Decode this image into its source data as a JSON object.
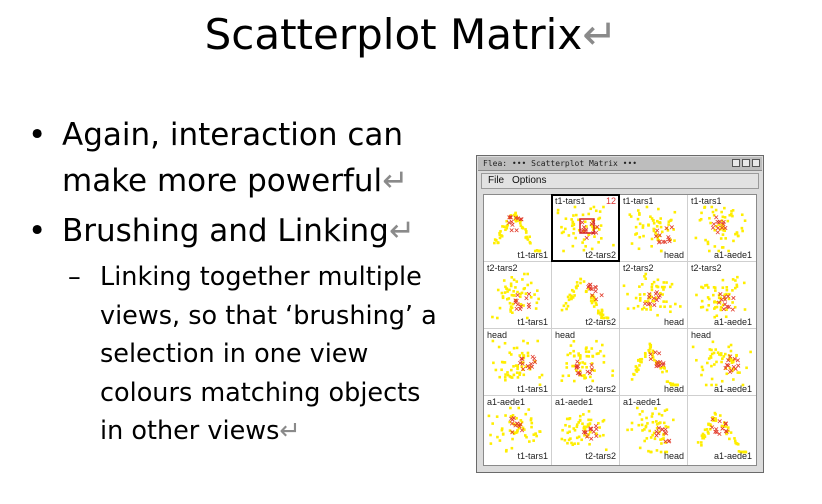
{
  "slide": {
    "title": "Scatterplot Matrix",
    "return_mark": "↵",
    "bullets": [
      {
        "text": "Again, interaction can make more powerful",
        "lines": [
          "Again, interaction can",
          "make more powerful"
        ]
      },
      {
        "text": "Brushing and Linking",
        "lines": [
          "Brushing and Linking"
        ]
      }
    ],
    "sub_bullet_lines": [
      "Linking together multiple",
      "views, so that ‘brushing’ a",
      "selection in one view",
      "colours matching objects",
      "in other views"
    ],
    "bullet_glyph": "•",
    "dash_glyph": "–"
  },
  "app": {
    "window_title": "Flea: ••• Scatterplot Matrix •••",
    "menu": [
      "File",
      "Options"
    ],
    "selected_count": "12",
    "variables": [
      "t1-tars1",
      "t2-tars2",
      "head",
      "a1-aede1"
    ],
    "colors": {
      "point": "#ffee00",
      "brushed": "#e23a2a",
      "selection_box": "#d42020"
    }
  }
}
